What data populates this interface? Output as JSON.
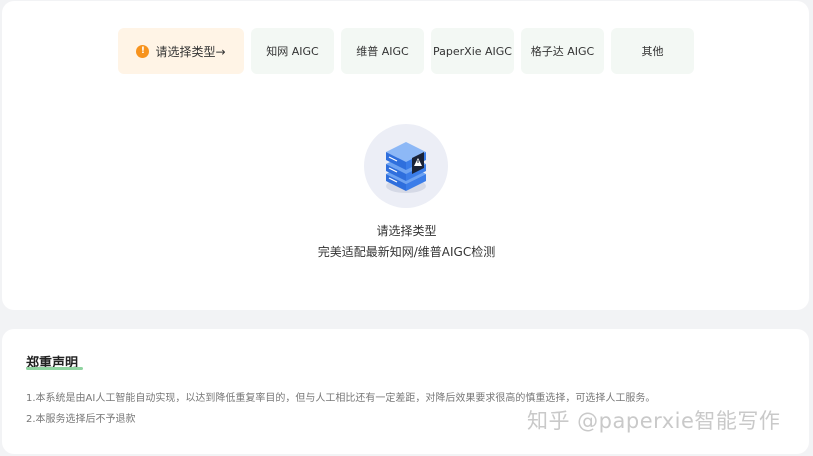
{
  "type_tabs": {
    "prompt": "请选择类型→",
    "items": [
      {
        "label": "知网 AIGC"
      },
      {
        "label": "维普 AIGC"
      },
      {
        "label": "PaperXie AIGC"
      },
      {
        "label": "格子达 AIGC"
      },
      {
        "label": "其他"
      }
    ]
  },
  "hero": {
    "icon": "server-stack-icon",
    "title": "请选择类型",
    "subtitle": "完美适配最新知网/维普AIGC检测"
  },
  "notice": {
    "title": "郑重声明",
    "lines": [
      "1.本系统是由AI人工智能自动实现，以达到降低重复率目的，但与人工相比还有一定差距，对降后效果要求很高的慎重选择，可选择人工服务。",
      "2.本服务选择后不予退款"
    ]
  },
  "watermark": "知乎 @paperxie智能写作",
  "colors": {
    "prompt_bg": "#fff4e6",
    "tab_bg": "#f3f8f4",
    "warning": "#f7931e",
    "accent_blue": "#3b7de9",
    "underline": "#8fd4a0"
  }
}
